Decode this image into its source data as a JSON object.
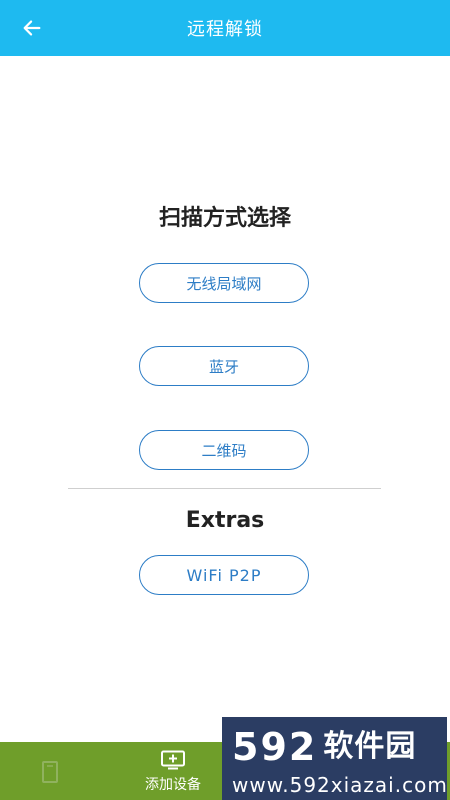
{
  "header": {
    "title": "远程解锁"
  },
  "scan": {
    "title": "扫描方式选择",
    "options": [
      {
        "label": "无线局域网"
      },
      {
        "label": "蓝牙"
      },
      {
        "label": "二维码"
      }
    ]
  },
  "extras": {
    "title": "Extras",
    "p2p_label": "WiFi P2P"
  },
  "bottom": {
    "add_device_label": "添加设备"
  },
  "watermark": {
    "number": "592",
    "name": "软件园",
    "url": "www.592xiazai.com"
  },
  "colors": {
    "header_bg": "#1ebaf0",
    "accent": "#2d7dc6",
    "bottom_bar": "#6f9e2a"
  }
}
